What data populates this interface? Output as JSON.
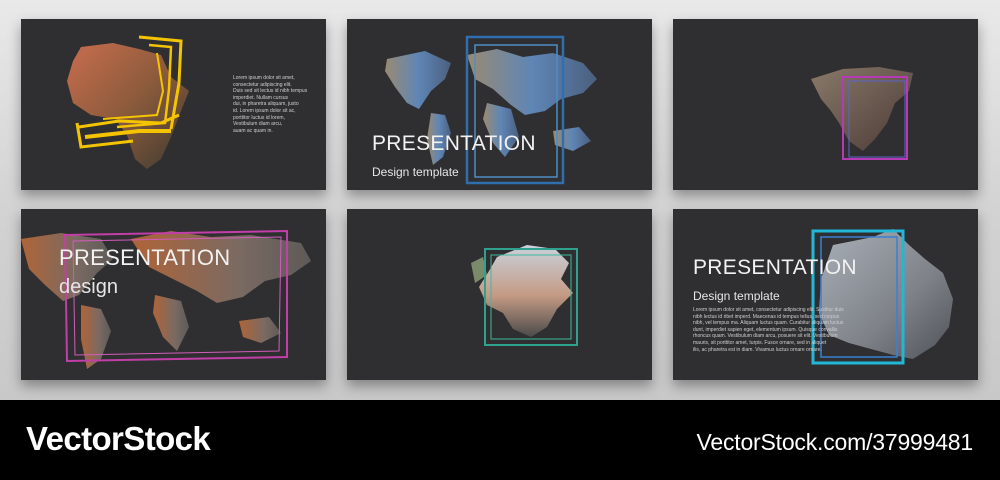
{
  "slides": {
    "s1": {
      "body": [
        "Lorem ipsum dolor sit amet,",
        "consectetur adipiscing elit.",
        "Duis sed sit lectus id nibh tempus",
        "imperdiet. Nullam cursus",
        "dui, in pharetra aliquam, justo",
        "id. Lorem ipsum dolor sit ac,",
        "porttitor luctus id lorem,",
        "Vestibulum diam arcu,",
        "auam ac quam in."
      ]
    },
    "s2": {
      "title": "PRESENTATION",
      "subtitle": "Design template"
    },
    "s4": {
      "title": "PRESENTATION",
      "subtitle": "design"
    },
    "s6": {
      "title": "PRESENTATION",
      "subtitle": "Design template",
      "body": [
        "Lorem ipsum dolor sit amet, consectetur adipiscing elit. Sustitur duis",
        "nibh lectus id ribet imperd. Maecenas id tempus tellus, sed curpus",
        "nibh, vel tempus ma. Aliquam luctus quam. Curabitur aliquam luctus",
        "dunt, imperdiet sapien eget, elementum ipsum. Quisque convallis",
        "rhoncus quam. Vestibulum diam arcu, posuere sit elit. Vestibulum",
        "mauris, sit porttitor amet, turpis. Fusce ornare, sed in aliquet",
        "ilis, ac pharetra est in diam. Vivamus luctus ornare ornare."
      ]
    }
  },
  "colors": {
    "slide_bg": "#2f2f31",
    "yellow": "#f5c400",
    "blue_frame": "#2f6fae",
    "pink": "#c23ea8",
    "teal": "#2fa28f",
    "cyan": "#22b7d6"
  },
  "footer": {
    "brand": "VectorStock",
    "stock_id": "VectorStock.com/37999481"
  }
}
